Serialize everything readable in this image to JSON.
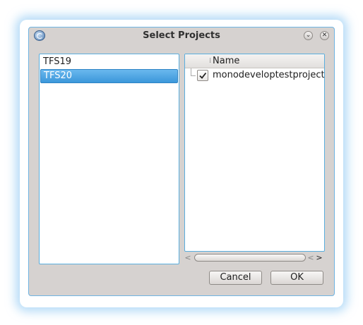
{
  "window": {
    "title": "Select Projects",
    "minimize_glyph": "⌄",
    "close_glyph": "✕"
  },
  "collections": {
    "items": [
      {
        "label": "TFS19",
        "selected": false
      },
      {
        "label": "TFS20",
        "selected": true
      }
    ]
  },
  "projects": {
    "column_header": "Name",
    "rows": [
      {
        "label": "monodeveloptestproject",
        "checked": true
      }
    ]
  },
  "scrollbar": {
    "left_arrow": "<",
    "right_arrow_1": "<",
    "right_arrow_2": ">"
  },
  "buttons": {
    "cancel": "Cancel",
    "ok": "OK"
  },
  "colors": {
    "accent": "#3b97da",
    "window_bg": "#d6d2d0",
    "focus_border": "#5aaede"
  },
  "icons": {
    "app": "monodevelop-icon",
    "minimize": "chevron-down-icon",
    "close": "close-icon",
    "check": "checkmark-icon"
  }
}
